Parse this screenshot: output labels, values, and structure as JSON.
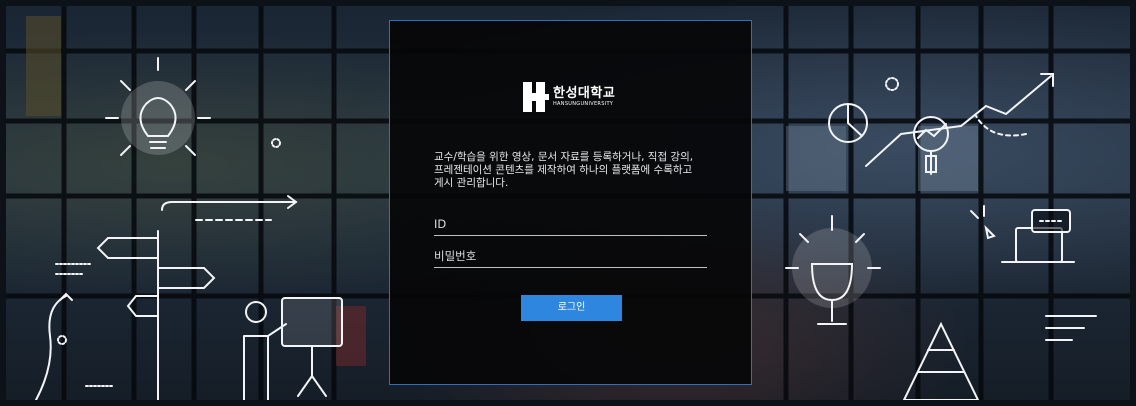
{
  "logo": {
    "name_kr": "한성대학교",
    "name_en": "HANSUNGUNIVERSITY"
  },
  "intro": {
    "line1": "교수/학습을 위한 영상, 문서 자료를 등록하거나, 직접 강의,",
    "line2": "프레젠테이션 콘텐츠를 제작하여 하나의 플랫폼에 수록하고",
    "line3": "게시 관리합니다."
  },
  "login_form": {
    "id_label": "ID",
    "password_label": "비밀번호",
    "submit_label": "로그인"
  },
  "colors": {
    "panel_border": "#2f6fc2",
    "button": "#2f86de"
  },
  "icons": [
    "lightbulb-icon",
    "signpost-icon",
    "presenter-icon",
    "pie-chart-icon",
    "magnifier-icon",
    "trend-arrow-icon",
    "laptop-chat-icon",
    "trophy-icon",
    "pyramid-icon"
  ]
}
